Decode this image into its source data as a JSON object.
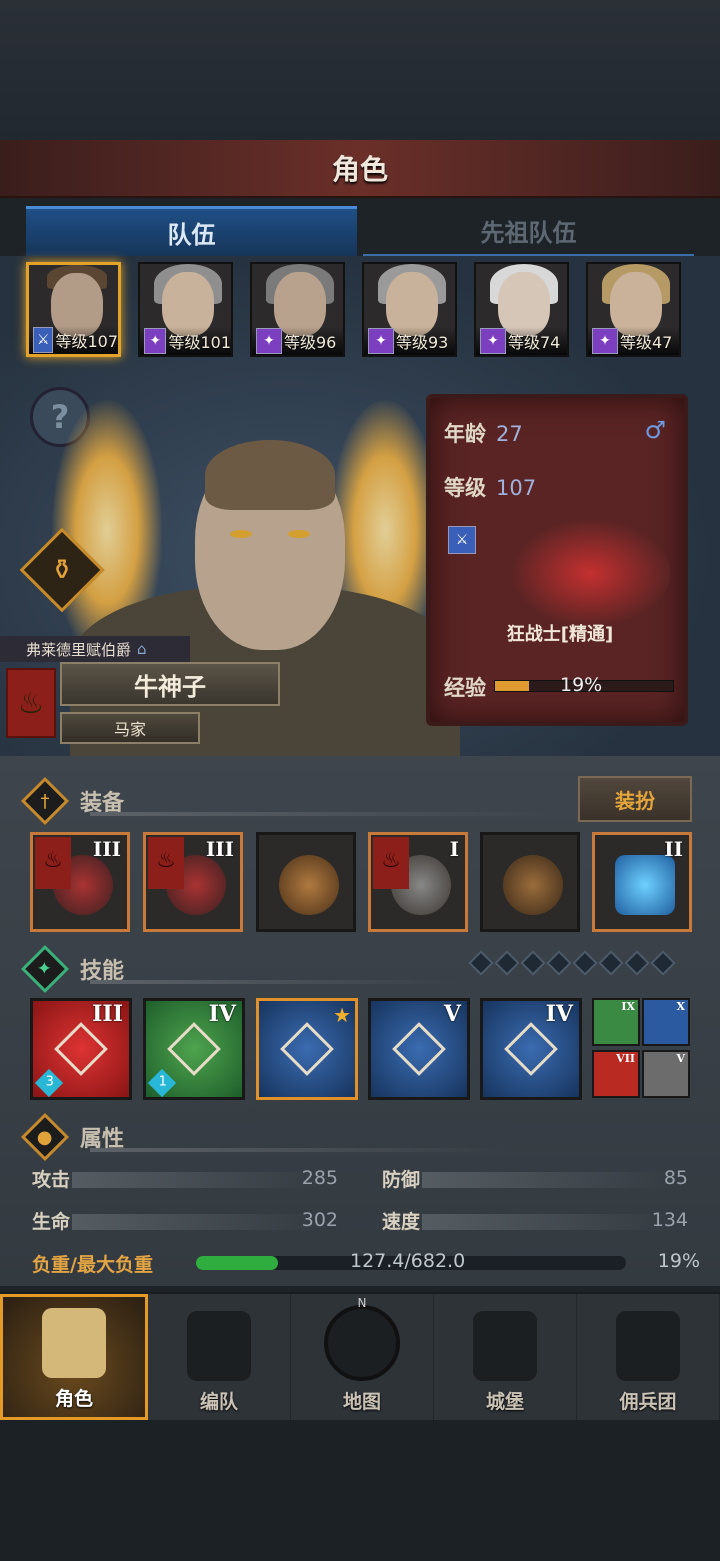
{
  "screen": {
    "title": "角色"
  },
  "tabs": [
    {
      "label": "队伍",
      "active": true
    },
    {
      "label": "先祖队伍",
      "active": false
    }
  ],
  "party": [
    {
      "level_label": "等级107",
      "weapon": "sword-icon",
      "selected": true
    },
    {
      "level_label": "等级101",
      "weapon": "staff-icon",
      "selected": false
    },
    {
      "level_label": "等级96",
      "weapon": "staff-icon",
      "selected": false
    },
    {
      "level_label": "等级93",
      "weapon": "staff-icon",
      "selected": false
    },
    {
      "level_label": "等级74",
      "weapon": "staff-icon",
      "selected": false
    },
    {
      "level_label": "等级47",
      "weapon": "staff-icon",
      "selected": false
    }
  ],
  "hero": {
    "title": "弗莱德里赋伯爵",
    "name": "牛神子",
    "house": "马家",
    "age_label": "年龄",
    "age": "27",
    "level_label": "等级",
    "level": "107",
    "gender_symbol": "♂",
    "class": "狂战士[精通]",
    "exp_label": "经验",
    "exp_percent": "19%",
    "exp_fraction": 0.19
  },
  "equipment": {
    "label": "装备",
    "dress_button": "装扮",
    "slots": [
      {
        "tier": "III",
        "flag": true,
        "icon": "axe-icon"
      },
      {
        "tier": "III",
        "flag": true,
        "icon": "axe-icon"
      },
      {
        "tier": "",
        "flag": false,
        "icon": "helmet-icon"
      },
      {
        "tier": "I",
        "flag": true,
        "icon": "armor-icon"
      },
      {
        "tier": "",
        "flag": false,
        "icon": "boots-icon"
      },
      {
        "tier": "II",
        "flag": false,
        "icon": "heart-amulet-icon"
      }
    ]
  },
  "skills": {
    "label": "技能",
    "main": [
      {
        "tier": "III",
        "color": "red",
        "level": "3",
        "icon": "slash-icon"
      },
      {
        "tier": "IV",
        "color": "green",
        "level": "1",
        "icon": "bird-strike-icon"
      },
      {
        "tier": "",
        "color": "blue",
        "level": "",
        "icon": "claw-icon",
        "star": true
      },
      {
        "tier": "V",
        "color": "blue",
        "level": "",
        "icon": "crystal-sword-icon"
      },
      {
        "tier": "IV",
        "color": "blue",
        "level": "",
        "icon": "crystal-bird-icon"
      }
    ],
    "mini": [
      {
        "tier": "IX",
        "color": "#3b8a44"
      },
      {
        "tier": "X",
        "color": "#2b5aa0"
      },
      {
        "tier": "VII",
        "color": "#b92a22"
      },
      {
        "tier": "V",
        "color": "#6c6c6c"
      }
    ]
  },
  "attributes": {
    "label": "属性",
    "attack_label": "攻击",
    "attack": "285",
    "defense_label": "防御",
    "defense": "85",
    "hp_label": "生命",
    "hp": "302",
    "speed_label": "速度",
    "speed": "134",
    "load_label": "负重/最大负重",
    "load": "127.4/682.0",
    "load_percent": "19%",
    "load_fraction": 0.19
  },
  "nav": [
    {
      "label": "角色",
      "active": true,
      "icon": "knight-icon"
    },
    {
      "label": "编队",
      "active": false,
      "icon": "helmet-icon"
    },
    {
      "label": "地图",
      "active": false,
      "icon": "compass-map-icon"
    },
    {
      "label": "城堡",
      "active": false,
      "icon": "castle-icon"
    },
    {
      "label": "佣兵团",
      "active": false,
      "icon": "mercenary-icon"
    }
  ],
  "nav_compass_letter": "N"
}
